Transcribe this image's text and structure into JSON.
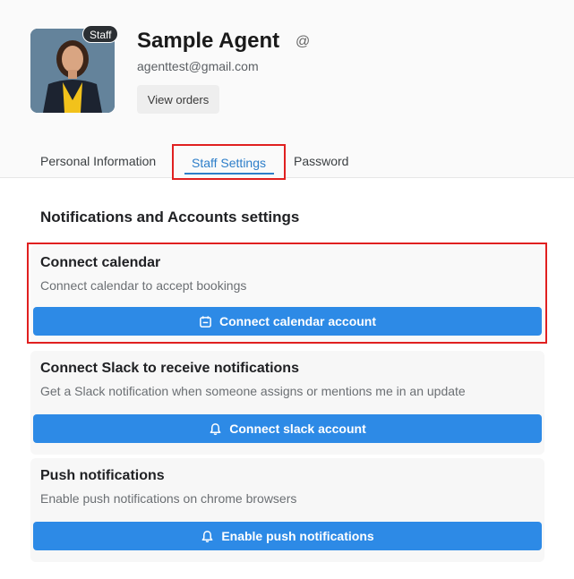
{
  "profile": {
    "name": "Sample Agent",
    "email": "agenttest@gmail.com",
    "badge": "Staff",
    "view_orders_label": "View orders"
  },
  "tabs": [
    {
      "label": "Personal Information"
    },
    {
      "label": "Staff Settings",
      "active": true
    },
    {
      "label": "Password"
    }
  ],
  "section_title": "Notifications and Accounts settings",
  "cards": [
    {
      "title": "Connect calendar",
      "description": "Connect calendar to accept bookings",
      "button_label": "Connect calendar account",
      "icon": "calendar-icon"
    },
    {
      "title": "Connect Slack to receive notifications",
      "description": "Get a Slack notification when someone assigns or mentions me in an update",
      "button_label": "Connect slack account",
      "icon": "bell-icon"
    },
    {
      "title": "Push notifications",
      "description": "Enable push notifications on chrome browsers",
      "button_label": "Enable push notifications",
      "icon": "bell-icon"
    }
  ],
  "colors": {
    "accent": "#2d8ae6",
    "active_tab": "#2d7ec9",
    "highlight": "#e02020"
  }
}
